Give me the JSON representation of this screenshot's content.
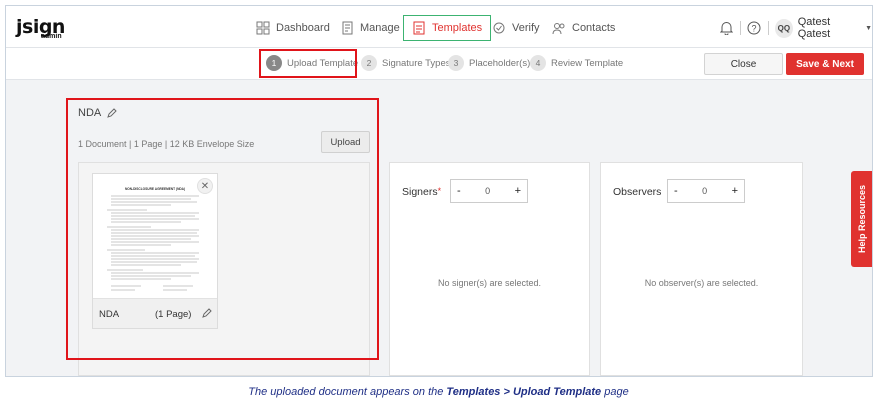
{
  "app": {
    "logo_text": "jsign",
    "logo_sub": "admin"
  },
  "nav": {
    "items": [
      {
        "label": "Dashboard",
        "icon": "dashboard-icon"
      },
      {
        "label": "Manage",
        "icon": "manage-icon"
      },
      {
        "label": "Templates",
        "icon": "templates-icon",
        "active": true
      },
      {
        "label": "Verify",
        "icon": "verify-icon"
      },
      {
        "label": "Contacts",
        "icon": "contacts-icon"
      }
    ],
    "user_initials": "QQ",
    "user_name": "Qatest Qatest"
  },
  "steps": [
    {
      "num": "1",
      "label": "Upload Template",
      "active": true
    },
    {
      "num": "2",
      "label": "Signature Types"
    },
    {
      "num": "3",
      "label": "Placeholder(s)"
    },
    {
      "num": "4",
      "label": "Review Template"
    }
  ],
  "actions": {
    "close": "Close",
    "save_next": "Save & Next"
  },
  "document": {
    "title": "NDA",
    "meta": "1 Document | 1 Page | 12 KB Envelope Size",
    "upload_label": "Upload",
    "card": {
      "name": "NDA",
      "pages": "(1 Page)",
      "thumb_heading": "NON-DISCLOSURE AGREEMENT (NDA)"
    }
  },
  "signers": {
    "label": "Signers",
    "required_mark": "*",
    "minus": "-",
    "plus": "+",
    "value": "0",
    "empty": "No signer(s) are selected."
  },
  "observers": {
    "label": "Observers",
    "minus": "-",
    "plus": "+",
    "value": "0",
    "empty": "No observer(s) are selected."
  },
  "help_tab": "Help Resources",
  "caption": {
    "pre": "The uploaded document appears on the ",
    "bold": "Templates > Upload Template",
    "post": " page"
  },
  "colors": {
    "accent": "#e0322f",
    "highlight_box": "#e0141a",
    "active_nav_border": "#3cb371",
    "caption": "#1f2f86"
  }
}
